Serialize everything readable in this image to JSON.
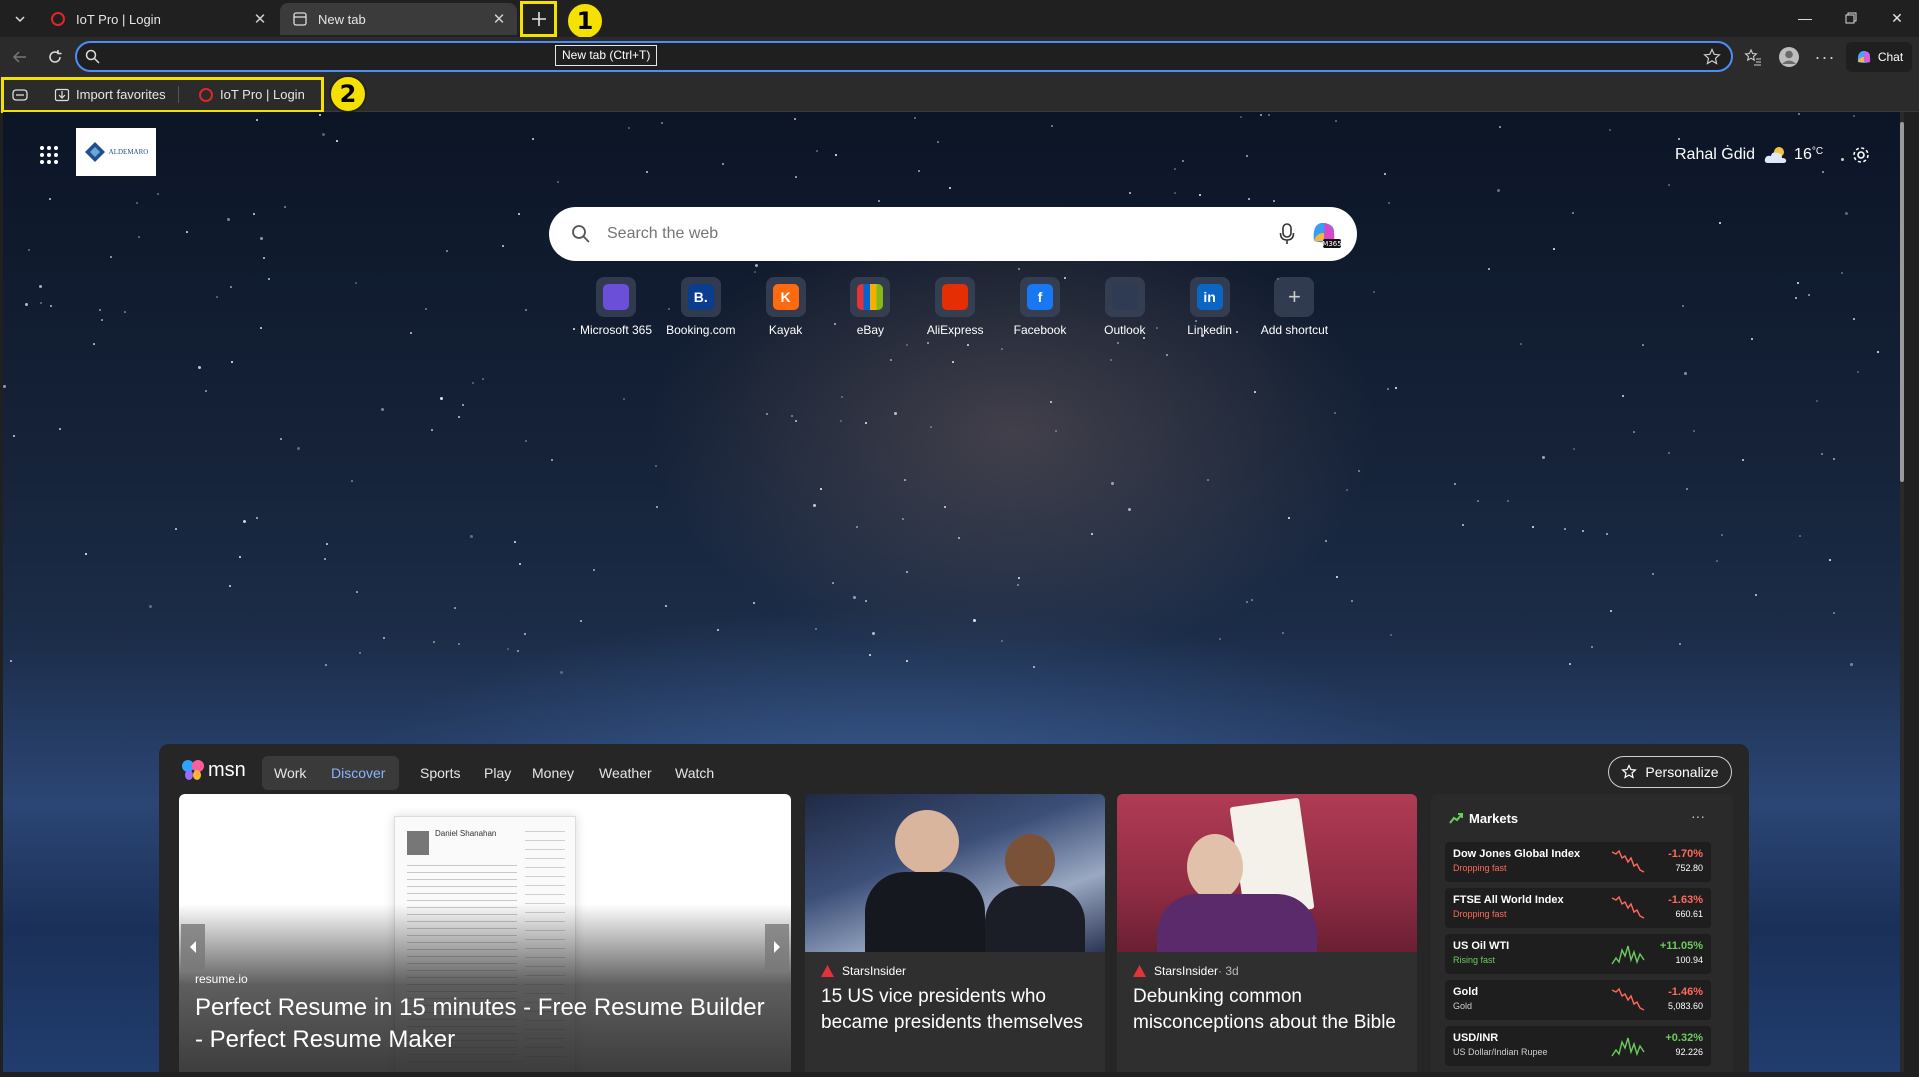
{
  "tabs": [
    {
      "title": "IoT Pro | Login"
    },
    {
      "title": "New tab"
    }
  ],
  "tooltip": "New tab (Ctrl+T)",
  "toolbar": {
    "chat_label": "Chat",
    "address_value": ""
  },
  "favorites_bar": {
    "items": [
      {
        "label": "Import favorites"
      },
      {
        "label": "IoT Pro | Login"
      }
    ]
  },
  "annotations": [
    "1",
    "2"
  ],
  "newtab": {
    "user_name": "Rahal Ġdid",
    "temperature": "16",
    "temp_unit": "°C",
    "search_placeholder": "Search the web",
    "logo_text": "ALDEMARO",
    "shortcuts": [
      {
        "label": "Microsoft 365",
        "glyph": "",
        "color": "#6b4fd8"
      },
      {
        "label": "Booking.com",
        "glyph": "B.",
        "color": "#0a3d8f"
      },
      {
        "label": "Kayak",
        "glyph": "K",
        "color": "#ff690f"
      },
      {
        "label": "eBay",
        "glyph": "",
        "color": "#3a3a3a"
      },
      {
        "label": "AliExpress",
        "glyph": "",
        "color": "#e62e04"
      },
      {
        "label": "Facebook",
        "glyph": "f",
        "color": "#1877f2"
      },
      {
        "label": "Outlook",
        "glyph": "",
        "color": "#2f3b52"
      },
      {
        "label": "Linkedin",
        "glyph": "in",
        "color": "#0a66c2"
      },
      {
        "label": "Add shortcut",
        "glyph": "+",
        "color": "transparent"
      }
    ]
  },
  "feed": {
    "brand": "msn",
    "nav": [
      "Work",
      "Discover",
      "Sports",
      "Play",
      "Money",
      "Weather",
      "Watch"
    ],
    "personalize_label": "Personalize",
    "hero": {
      "source": "resume.io",
      "title": "Perfect Resume in 15 minutes - Free Resume Builder - Perfect Resume Maker",
      "resume_name": "Daniel Shanahan"
    },
    "cards": [
      {
        "source": "StarsInsider",
        "meta": "",
        "title": "15 US vice presidents who became presidents themselves"
      },
      {
        "source": "StarsInsider",
        "meta": " · 3d",
        "title": "Debunking common misconceptions about the Bible"
      }
    ],
    "markets": {
      "title": "Markets",
      "more": "···",
      "rows": [
        {
          "name": "Dow Jones Global Index",
          "sub": "Dropping fast",
          "change": "-1.70%",
          "value": "752.80",
          "trend": "down"
        },
        {
          "name": "FTSE All World Index",
          "sub": "Dropping fast",
          "change": "-1.63%",
          "value": "660.61",
          "trend": "down"
        },
        {
          "name": "US Oil WTI",
          "sub": "Rising fast",
          "change": "+11.05%",
          "value": "100.94",
          "trend": "up"
        },
        {
          "name": "Gold",
          "sub": "Gold",
          "change": "-1.46%",
          "value": "5,083.60",
          "trend": "down"
        },
        {
          "name": "USD/INR",
          "sub": "US Dollar/Indian Rupee",
          "change": "+0.32%",
          "value": "92.226",
          "trend": "up"
        }
      ]
    }
  },
  "colors": {
    "accent": "#4c8df6",
    "down": "#ff6a5b",
    "up": "#6ccb5f",
    "highlight": "#f5e100"
  }
}
